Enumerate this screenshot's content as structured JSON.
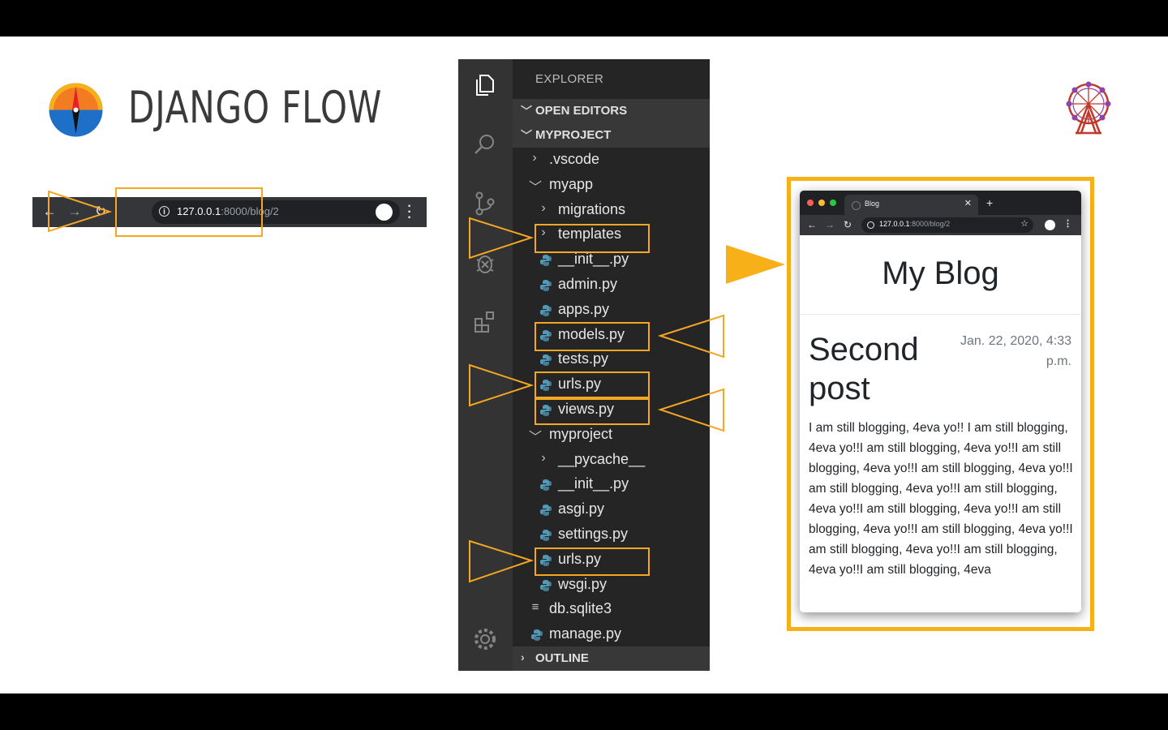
{
  "slide": {
    "title": "DJANGO FLOW"
  },
  "browser_bar": {
    "url_host": "127.0.0.1",
    "url_path": ":8000/blog/2"
  },
  "explorer": {
    "header": "EXPLORER",
    "sections": {
      "open_editors": "OPEN EDITORS",
      "project": "MYPROJECT",
      "outline": "OUTLINE"
    },
    "tree": [
      {
        "label": ".vscode",
        "type": "folder",
        "expanded": false
      },
      {
        "label": "myapp",
        "type": "folder",
        "expanded": true
      },
      {
        "label": "migrations",
        "type": "folder",
        "expanded": false
      },
      {
        "label": "templates",
        "type": "folder",
        "expanded": false,
        "highlighted": true
      },
      {
        "label": "__init__.py",
        "type": "python"
      },
      {
        "label": "admin.py",
        "type": "python"
      },
      {
        "label": "apps.py",
        "type": "python"
      },
      {
        "label": "models.py",
        "type": "python",
        "highlighted": true
      },
      {
        "label": "tests.py",
        "type": "python"
      },
      {
        "label": "urls.py",
        "type": "python",
        "highlighted": true
      },
      {
        "label": "views.py",
        "type": "python",
        "highlighted": true
      },
      {
        "label": "myproject",
        "type": "folder",
        "expanded": true
      },
      {
        "label": "__pycache__",
        "type": "folder",
        "expanded": false
      },
      {
        "label": "__init__.py",
        "type": "python"
      },
      {
        "label": "asgi.py",
        "type": "python"
      },
      {
        "label": "settings.py",
        "type": "python"
      },
      {
        "label": "urls.py",
        "type": "python",
        "highlighted": true
      },
      {
        "label": "wsgi.py",
        "type": "python"
      },
      {
        "label": "db.sqlite3",
        "type": "text"
      },
      {
        "label": "manage.py",
        "type": "python"
      }
    ]
  },
  "blog_window": {
    "tab_title": "Blog",
    "url_host": "127.0.0.1",
    "url_path": ":8000/blog/2",
    "site_title": "My Blog",
    "post_title": "Second post",
    "post_date": "Jan. 22, 2020, 4:33 p.m.",
    "post_body": "I am still blogging, 4eva yo!! I am still blogging, 4eva yo!!I am still blogging, 4eva yo!!I am still blogging, 4eva yo!!I am still blogging, 4eva yo!!I am still blogging, 4eva yo!!I am still blogging, 4eva yo!!I am still blogging, 4eva yo!!I am still blogging, 4eva yo!!I am still blogging, 4eva yo!!I am still blogging, 4eva yo!!I am still blogging, 4eva yo!!I am still blogging, 4eva"
  },
  "colors": {
    "highlight": "#f5a623",
    "frame": "#f7b018",
    "vscode_bg": "#252526",
    "activity_bg": "#333333",
    "python_icon": "#519aba"
  }
}
